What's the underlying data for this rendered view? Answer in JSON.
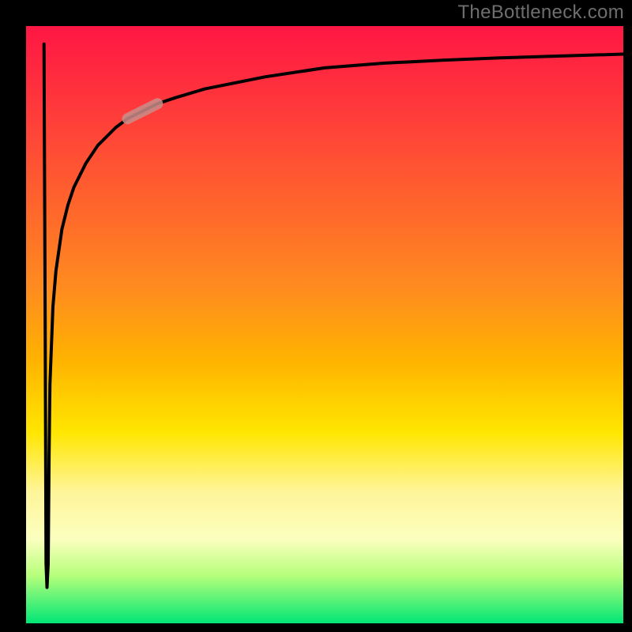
{
  "watermark": "TheBottleneck.com",
  "chart_data": {
    "type": "line",
    "title": "",
    "xlabel": "",
    "ylabel": "",
    "xlim": [
      0,
      100
    ],
    "ylim": [
      0,
      100
    ],
    "grid": false,
    "series": [
      {
        "name": "curve",
        "x": [
          3.0,
          3.2,
          3.35,
          3.5,
          3.7,
          3.85,
          4.0,
          4.5,
          5.0,
          6.0,
          7.0,
          8.0,
          10.0,
          12.0,
          15.0,
          17.0,
          19.0,
          22.0,
          25.0,
          30.0,
          40.0,
          50.0,
          60.0,
          70.0,
          80.0,
          90.0,
          100.0
        ],
        "y": [
          97.0,
          50.0,
          10.0,
          6.0,
          10.0,
          28.0,
          40.0,
          53.0,
          59.0,
          66.0,
          70.0,
          73.0,
          77.0,
          80.0,
          83.0,
          84.5,
          85.5,
          87.0,
          88.0,
          89.5,
          91.5,
          93.0,
          93.8,
          94.3,
          94.7,
          95.0,
          95.3
        ]
      }
    ],
    "highlight_segment": {
      "x_start": 17.0,
      "x_end": 22.0
    },
    "gradient_stops": [
      {
        "pos": 0.0,
        "color": "#ff1744"
      },
      {
        "pos": 0.2,
        "color": "#ff4a36"
      },
      {
        "pos": 0.44,
        "color": "#ff8c1f"
      },
      {
        "pos": 0.68,
        "color": "#ffe600"
      },
      {
        "pos": 0.86,
        "color": "#fbffbf"
      },
      {
        "pos": 1.0,
        "color": "#00e676"
      }
    ]
  }
}
